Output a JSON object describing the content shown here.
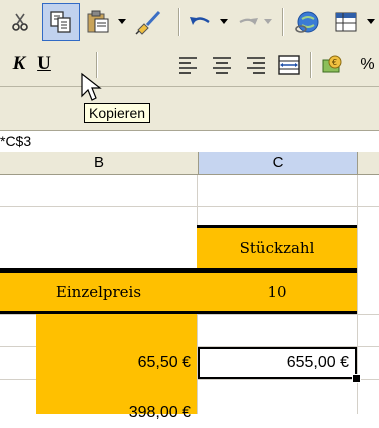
{
  "tooltip": "Kopieren",
  "formula_bar": {
    "name_box": "*C$3"
  },
  "columns": [
    "B",
    "C"
  ],
  "cells": {
    "c_stueckzahl": "Stückzahl",
    "b_einzelpreis": "Einzelpreis",
    "c_einzelpreis_value": "10",
    "b_price1": "65,50 €",
    "c_total1": "655,00 €",
    "b_price2": "398,00 €"
  },
  "colors": {
    "highlight": "#ffc000",
    "toolbar_bg": "#ece9d8",
    "selected_header": "#c6d5f0"
  }
}
